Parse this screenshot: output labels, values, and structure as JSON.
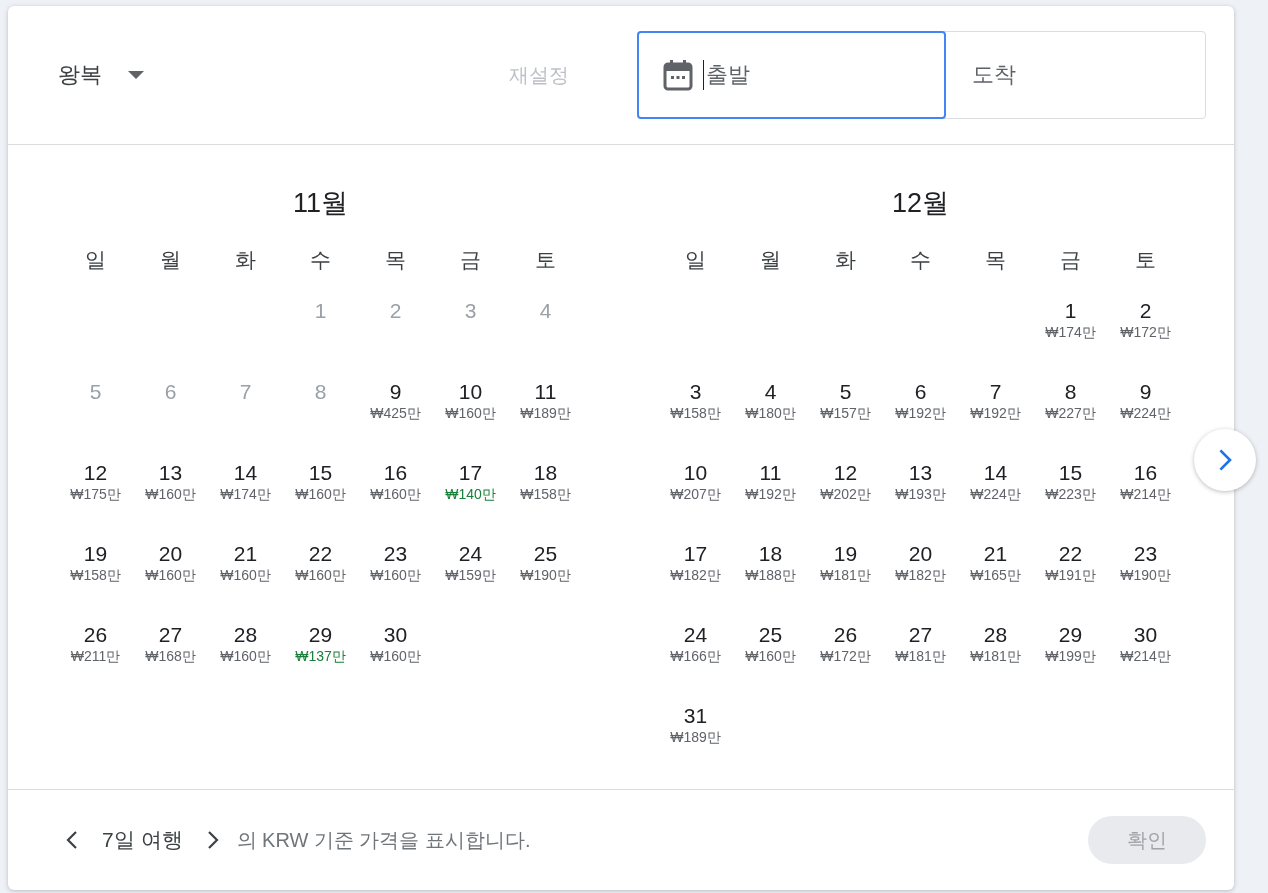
{
  "trip_type": {
    "label": "왕복"
  },
  "reset": {
    "label": "재설정",
    "disabled": true
  },
  "fields": [
    {
      "kind": "departure",
      "placeholder": "출발",
      "focused": true
    },
    {
      "kind": "return",
      "placeholder": "도착",
      "focused": false
    }
  ],
  "months": [
    {
      "title": "11월",
      "weekdays": [
        "일",
        "월",
        "화",
        "수",
        "목",
        "금",
        "토"
      ],
      "weeks": [
        [
          {
            "kind": "blank"
          },
          {
            "kind": "blank"
          },
          {
            "kind": "blank"
          },
          {
            "kind": "day",
            "day": "1",
            "disabled": true
          },
          {
            "kind": "day",
            "day": "2",
            "disabled": true
          },
          {
            "kind": "day",
            "day": "3",
            "disabled": true
          },
          {
            "kind": "day",
            "day": "4",
            "disabled": true
          }
        ],
        [
          {
            "kind": "day",
            "day": "5",
            "disabled": true
          },
          {
            "kind": "day",
            "day": "6",
            "disabled": true
          },
          {
            "kind": "day",
            "day": "7",
            "disabled": true
          },
          {
            "kind": "day",
            "day": "8",
            "disabled": true
          },
          {
            "kind": "day",
            "day": "9",
            "price": "₩425만",
            "low": false,
            "disabled": false
          },
          {
            "kind": "day",
            "day": "10",
            "price": "₩160만",
            "low": false,
            "disabled": false
          },
          {
            "kind": "day",
            "day": "11",
            "price": "₩189만",
            "low": false,
            "disabled": false
          }
        ],
        [
          {
            "kind": "day",
            "day": "12",
            "price": "₩175만",
            "low": false,
            "disabled": false
          },
          {
            "kind": "day",
            "day": "13",
            "price": "₩160만",
            "low": false,
            "disabled": false
          },
          {
            "kind": "day",
            "day": "14",
            "price": "₩174만",
            "low": false,
            "disabled": false
          },
          {
            "kind": "day",
            "day": "15",
            "price": "₩160만",
            "low": false,
            "disabled": false
          },
          {
            "kind": "day",
            "day": "16",
            "price": "₩160만",
            "low": false,
            "disabled": false
          },
          {
            "kind": "day",
            "day": "17",
            "price": "₩140만",
            "low": true,
            "disabled": false
          },
          {
            "kind": "day",
            "day": "18",
            "price": "₩158만",
            "low": false,
            "disabled": false
          }
        ],
        [
          {
            "kind": "day",
            "day": "19",
            "price": "₩158만",
            "low": false,
            "disabled": false
          },
          {
            "kind": "day",
            "day": "20",
            "price": "₩160만",
            "low": false,
            "disabled": false
          },
          {
            "kind": "day",
            "day": "21",
            "price": "₩160만",
            "low": false,
            "disabled": false
          },
          {
            "kind": "day",
            "day": "22",
            "price": "₩160만",
            "low": false,
            "disabled": false
          },
          {
            "kind": "day",
            "day": "23",
            "price": "₩160만",
            "low": false,
            "disabled": false
          },
          {
            "kind": "day",
            "day": "24",
            "price": "₩159만",
            "low": false,
            "disabled": false
          },
          {
            "kind": "day",
            "day": "25",
            "price": "₩190만",
            "low": false,
            "disabled": false
          }
        ],
        [
          {
            "kind": "day",
            "day": "26",
            "price": "₩211만",
            "low": false,
            "disabled": false
          },
          {
            "kind": "day",
            "day": "27",
            "price": "₩168만",
            "low": false,
            "disabled": false
          },
          {
            "kind": "day",
            "day": "28",
            "price": "₩160만",
            "low": false,
            "disabled": false
          },
          {
            "kind": "day",
            "day": "29",
            "price": "₩137만",
            "low": true,
            "disabled": false
          },
          {
            "kind": "day",
            "day": "30",
            "price": "₩160만",
            "low": false,
            "disabled": false
          }
        ]
      ]
    },
    {
      "title": "12월",
      "weekdays": [
        "일",
        "월",
        "화",
        "수",
        "목",
        "금",
        "토"
      ],
      "weeks": [
        [
          {
            "kind": "blank"
          },
          {
            "kind": "blank"
          },
          {
            "kind": "blank"
          },
          {
            "kind": "blank"
          },
          {
            "kind": "blank"
          },
          {
            "kind": "day",
            "day": "1",
            "price": "₩174만",
            "low": false,
            "disabled": false
          },
          {
            "kind": "day",
            "day": "2",
            "price": "₩172만",
            "low": false,
            "disabled": false
          }
        ],
        [
          {
            "kind": "day",
            "day": "3",
            "price": "₩158만",
            "low": false,
            "disabled": false
          },
          {
            "kind": "day",
            "day": "4",
            "price": "₩180만",
            "low": false,
            "disabled": false
          },
          {
            "kind": "day",
            "day": "5",
            "price": "₩157만",
            "low": false,
            "disabled": false
          },
          {
            "kind": "day",
            "day": "6",
            "price": "₩192만",
            "low": false,
            "disabled": false
          },
          {
            "kind": "day",
            "day": "7",
            "price": "₩192만",
            "low": false,
            "disabled": false
          },
          {
            "kind": "day",
            "day": "8",
            "price": "₩227만",
            "low": false,
            "disabled": false
          },
          {
            "kind": "day",
            "day": "9",
            "price": "₩224만",
            "low": false,
            "disabled": false
          }
        ],
        [
          {
            "kind": "day",
            "day": "10",
            "price": "₩207만",
            "low": false,
            "disabled": false
          },
          {
            "kind": "day",
            "day": "11",
            "price": "₩192만",
            "low": false,
            "disabled": false
          },
          {
            "kind": "day",
            "day": "12",
            "price": "₩202만",
            "low": false,
            "disabled": false
          },
          {
            "kind": "day",
            "day": "13",
            "price": "₩193만",
            "low": false,
            "disabled": false
          },
          {
            "kind": "day",
            "day": "14",
            "price": "₩224만",
            "low": false,
            "disabled": false
          },
          {
            "kind": "day",
            "day": "15",
            "price": "₩223만",
            "low": false,
            "disabled": false
          },
          {
            "kind": "day",
            "day": "16",
            "price": "₩214만",
            "low": false,
            "disabled": false
          }
        ],
        [
          {
            "kind": "day",
            "day": "17",
            "price": "₩182만",
            "low": false,
            "disabled": false
          },
          {
            "kind": "day",
            "day": "18",
            "price": "₩188만",
            "low": false,
            "disabled": false
          },
          {
            "kind": "day",
            "day": "19",
            "price": "₩181만",
            "low": false,
            "disabled": false
          },
          {
            "kind": "day",
            "day": "20",
            "price": "₩182만",
            "low": false,
            "disabled": false
          },
          {
            "kind": "day",
            "day": "21",
            "price": "₩165만",
            "low": false,
            "disabled": false
          },
          {
            "kind": "day",
            "day": "22",
            "price": "₩191만",
            "low": false,
            "disabled": false
          },
          {
            "kind": "day",
            "day": "23",
            "price": "₩190만",
            "low": false,
            "disabled": false
          }
        ],
        [
          {
            "kind": "day",
            "day": "24",
            "price": "₩166만",
            "low": false,
            "disabled": false
          },
          {
            "kind": "day",
            "day": "25",
            "price": "₩160만",
            "low": false,
            "disabled": false
          },
          {
            "kind": "day",
            "day": "26",
            "price": "₩172만",
            "low": false,
            "disabled": false
          },
          {
            "kind": "day",
            "day": "27",
            "price": "₩181만",
            "low": false,
            "disabled": false
          },
          {
            "kind": "day",
            "day": "28",
            "price": "₩181만",
            "low": false,
            "disabled": false
          },
          {
            "kind": "day",
            "day": "29",
            "price": "₩199만",
            "low": false,
            "disabled": false
          },
          {
            "kind": "day",
            "day": "30",
            "price": "₩214만",
            "low": false,
            "disabled": false
          }
        ],
        [
          {
            "kind": "day",
            "day": "31",
            "price": "₩189만",
            "low": false,
            "disabled": false
          }
        ]
      ]
    }
  ],
  "footer": {
    "duration": "7일 여행",
    "note": "의 KRW 기준 가격을 표시합니다.",
    "confirm": {
      "label": "확인",
      "disabled": true
    }
  }
}
